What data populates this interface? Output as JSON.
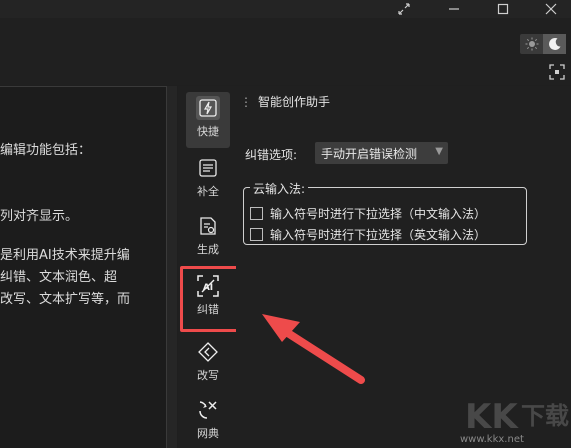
{
  "window": {
    "buttons": [
      "restore-down-icon",
      "minimize-icon",
      "maximize-icon",
      "close-icon"
    ]
  },
  "theme_toggle": {
    "light_icon": "sun-icon",
    "dark_icon": "moon-icon",
    "active": "dark"
  },
  "document": {
    "lines": [
      "编辑功能包括：",
      "列对齐显示。",
      "是利用AI技术来提升编",
      "纠错、文本润色、超",
      "改写、文本扩写等，而"
    ]
  },
  "rail": {
    "items": [
      {
        "label": "快捷",
        "icon": "lightning-icon"
      },
      {
        "label": "补全",
        "icon": "document-complete-icon"
      },
      {
        "label": "生成",
        "icon": "document-generate-icon"
      },
      {
        "label": "纠错",
        "icon": "ai-scan-icon"
      },
      {
        "label": "改写",
        "icon": "diamond-rewrite-icon"
      },
      {
        "label": "网典",
        "icon": "translate-icon"
      }
    ]
  },
  "panel": {
    "title": "智能创作助手",
    "correction_label": "纠错选项:",
    "correction_selected": "手动开启错误检测",
    "cloud_ime_label": "云输入法:",
    "options": [
      "输入符号时进行下拉选择（中文输入法）",
      "输入符号时进行下拉选择（英文输入法）"
    ]
  },
  "watermark": {
    "text": "www.kkx.net",
    "logo": "KK下载"
  },
  "colors": {
    "highlight": "#ee4b4b",
    "background": "#1f1f1f"
  }
}
